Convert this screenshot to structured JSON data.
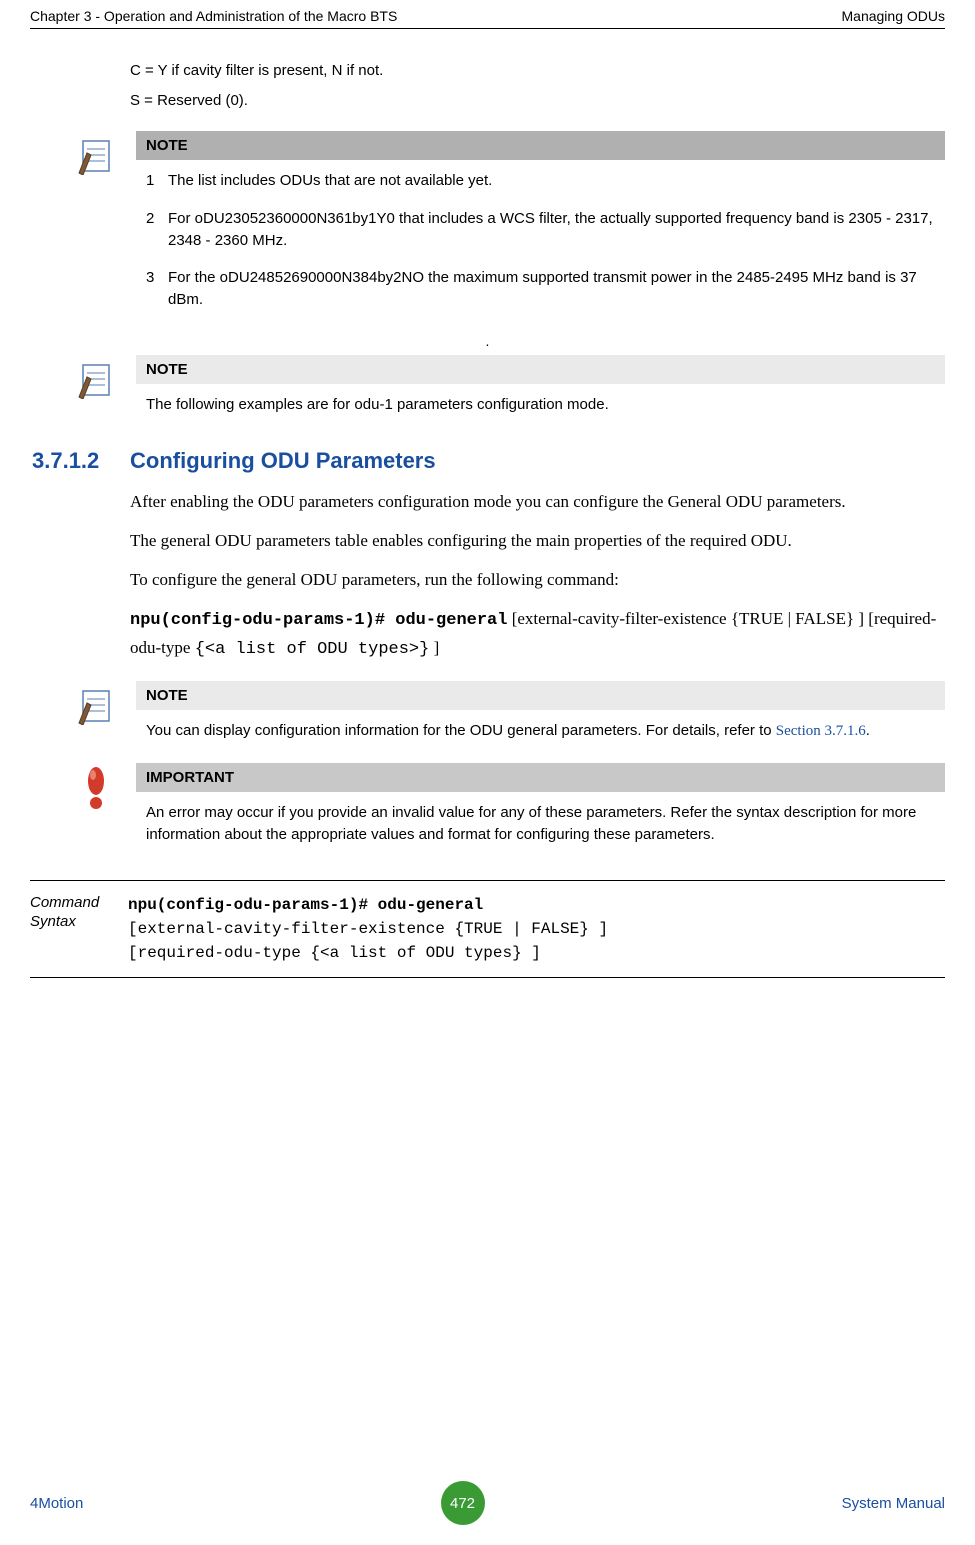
{
  "header": {
    "left": "Chapter 3 - Operation and Administration of the Macro BTS",
    "right": "Managing ODUs"
  },
  "intro": {
    "line1": "C = Y if cavity filter is present, N if not.",
    "line2": "S = Reserved (0)."
  },
  "note1": {
    "label": "NOTE",
    "items": [
      {
        "num": "1",
        "text": "The list includes ODUs that are not available yet."
      },
      {
        "num": "2",
        "text": "For oDU23052360000N361by1Y0 that includes a WCS filter, the actually supported frequency band is 2305 - 2317, 2348 - 2360 MHz."
      },
      {
        "num": "3",
        "text": "For the oDU24852690000N384by2NO the maximum supported transmit power in the 2485-2495 MHz band is 37 dBm."
      }
    ]
  },
  "centerDot": ".",
  "note2": {
    "label": "NOTE",
    "text": "The following examples are for odu-1 parameters configuration mode."
  },
  "section": {
    "num": "3.7.1.2",
    "title": "Configuring ODU Parameters",
    "para1": "After enabling the ODU parameters configuration mode you can configure the General ODU parameters.",
    "para2": "The general ODU parameters table enables configuring the main properties of the required ODU.",
    "para3": "To configure the general ODU parameters, run the following command:",
    "cmd_mono1": "npu(config-odu-params-1)# odu-general",
    "cmd_plain1": " [external-cavity-filter-existence {TRUE | FALSE} ] [required-odu-type ",
    "cmd_mono2": "{<a list of ODU types>}",
    "cmd_plain2": " ]"
  },
  "note3": {
    "label": "NOTE",
    "text_before": "You can display configuration information for the ODU general parameters. For details, refer to ",
    "link": "Section 3.7.1.6",
    "text_after": "."
  },
  "important": {
    "label": "IMPORTANT",
    "text": "An error may occur if you provide an invalid value for any of these parameters. Refer the syntax description for more information about the appropriate values and format for configuring these parameters."
  },
  "syntax": {
    "label": "Command Syntax",
    "line1": "npu(config-odu-params-1)# odu-general",
    "line2": "[external-cavity-filter-existence {TRUE | FALSE} ]",
    "line3": "[required-odu-type {<a list of ODU types} ]"
  },
  "footer": {
    "left": "4Motion",
    "page": "472",
    "right": "System Manual"
  }
}
